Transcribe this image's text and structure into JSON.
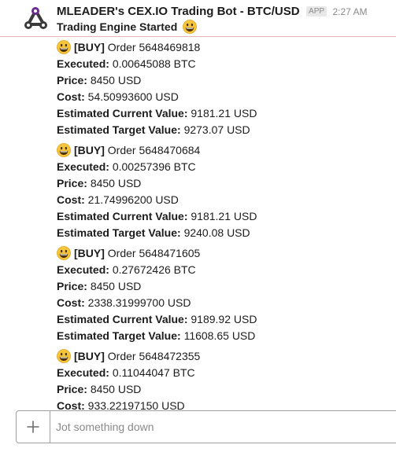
{
  "message": {
    "bot_name": "MLEADER's CEX.IO Trading Bot - BTC/USD",
    "app_badge": "APP",
    "time": "2:27 AM",
    "subtitle": "Trading Engine Started",
    "subtitle_icon": "grinning-face-emoji"
  },
  "labels": {
    "executed": "Executed:",
    "price": "Price:",
    "cost": "Cost:",
    "est_current": "Estimated Current Value:",
    "est_target": "Estimated Target Value:"
  },
  "orders": [
    {
      "side": "[BUY]",
      "order": "Order 5648469818",
      "executed": "0.00645088 BTC",
      "price": "8450 USD",
      "cost": "54.50993600 USD",
      "est_current": "9181.21 USD",
      "est_target": "9273.07 USD"
    },
    {
      "side": "[BUY]",
      "order": "Order 5648470684",
      "executed": "0.00257396 BTC",
      "price": "8450 USD",
      "cost": "21.74996200 USD",
      "est_current": "9181.21 USD",
      "est_target": "9240.08 USD"
    },
    {
      "side": "[BUY]",
      "order": "Order 5648471605",
      "executed": "0.27672426 BTC",
      "price": "8450 USD",
      "cost": "2338.31999700 USD",
      "est_current": "9189.92 USD",
      "est_target": "11608.65 USD"
    },
    {
      "side": "[BUY]",
      "order": "Order 5648472355",
      "executed": "0.11044047 BTC",
      "price": "8450 USD",
      "cost": "933.22197150 USD"
    }
  ],
  "composer": {
    "placeholder": "Jot something down"
  },
  "colors": {
    "header_rule": "#e0b8b8",
    "muted": "#8a8a8a",
    "text": "#1d1c1d",
    "emoji_face": "#f7c53a"
  }
}
